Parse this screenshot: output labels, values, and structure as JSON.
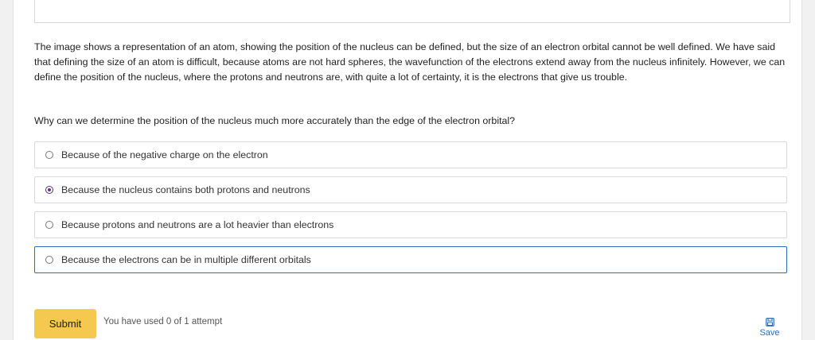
{
  "passage": "The image shows a representation of an atom, showing the position of the nucleus can be defined, but the size of an electron orbital cannot be well defined. We have said that defining the size of an atom is difficult, because atoms are not hard spheres, the wavefunction of the electrons extend away from the nucleus infinitely. However, we can define the position of the nucleus, where the protons and neutrons are, with quite a lot of certainty, it is the electrons that give us trouble.",
  "question": "Why can we determine the position of the nucleus much more accurately than the edge of the electron orbital?",
  "options": [
    {
      "label": "Because of the negative charge on the electron"
    },
    {
      "label": "Because the nucleus contains both protons and neutrons"
    },
    {
      "label": "Because protons and neutrons are a lot heavier than electrons"
    },
    {
      "label": "Because the electrons can be in multiple different orbitals"
    }
  ],
  "selected_option": 1,
  "submit_label": "Submit",
  "attempts_text": "You have used 0 of 1 attempt",
  "save_label": "Save",
  "colors": {
    "accent": "#2a6db3",
    "submit_bg": "#f5c84f",
    "radio_checked": "#6d2c8f"
  }
}
